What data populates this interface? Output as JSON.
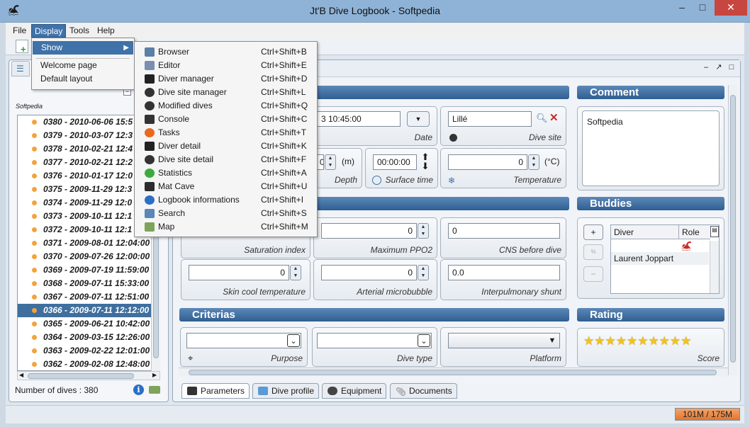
{
  "window": {
    "title": "Jt'B Dive Logbook - Softpedia"
  },
  "menubar": {
    "items": [
      "File",
      "Display",
      "Tools",
      "Help"
    ]
  },
  "display_menu": {
    "show_label": "Show",
    "welcome_page": "Welcome page",
    "default_layout": "Default layout"
  },
  "show_menu": {
    "items": [
      {
        "label": "Browser",
        "shortcut": "Ctrl+Shift+B",
        "icon": "browser-icon"
      },
      {
        "label": "Editor",
        "shortcut": "Ctrl+Shift+E",
        "icon": "editor-icon"
      },
      {
        "label": "Diver manager",
        "shortcut": "Ctrl+Shift+D",
        "icon": "diver-icon"
      },
      {
        "label": "Dive site manager",
        "shortcut": "Ctrl+Shift+L",
        "icon": "globe-icon"
      },
      {
        "label": "Modified dives",
        "shortcut": "Ctrl+Shift+Q",
        "icon": "globe-icon"
      },
      {
        "label": "Console",
        "shortcut": "Ctrl+Shift+C",
        "icon": "console-icon"
      },
      {
        "label": "Tasks",
        "shortcut": "Ctrl+Shift+T",
        "icon": "tasks-icon"
      },
      {
        "label": "Diver detail",
        "shortcut": "Ctrl+Shift+K",
        "icon": "diver-icon"
      },
      {
        "label": "Dive site detail",
        "shortcut": "Ctrl+Shift+F",
        "icon": "globe-icon"
      },
      {
        "label": "Statistics",
        "shortcut": "Ctrl+Shift+A",
        "icon": "pie-chart-icon"
      },
      {
        "label": "Mat Cave",
        "shortcut": "Ctrl+Shift+U",
        "icon": "batman-icon"
      },
      {
        "label": "Logbook informations",
        "shortcut": "Ctrl+Shift+I",
        "icon": "info-icon"
      },
      {
        "label": "Search",
        "shortcut": "Ctrl+Shift+S",
        "icon": "magnifier-icon"
      },
      {
        "label": "Map",
        "shortcut": "Ctrl+Shift+M",
        "icon": "map-icon"
      }
    ]
  },
  "left_panel": {
    "title": "Softpedia",
    "dives": [
      "0380 - 2010-06-06 15:5",
      "0379 - 2010-03-07 12:3",
      "0378 - 2010-02-21 12:4",
      "0377 - 2010-02-21 12:2",
      "0376 - 2010-01-17 12:0",
      "0375 - 2009-11-29 12:3",
      "0374 - 2009-11-29 12:0",
      "0373 - 2009-10-11 12:1",
      "0372 - 2009-10-11 12:1",
      "0371 - 2009-08-01 12:04:00",
      "0370 - 2009-07-26 12:00:00",
      "0369 - 2009-07-19 11:59:00",
      "0368 - 2009-07-11 15:33:00",
      "0367 - 2009-07-11 12:51:00",
      "0366 - 2009-07-11 12:12:00",
      "0365 - 2009-06-21 10:42:00",
      "0364 - 2009-03-15 12:26:00",
      "0363 - 2009-02-22 12:01:00",
      "0362 - 2009-02-08 12:48:00"
    ],
    "selected_index": 14,
    "dive_count": "Number of dives : 380"
  },
  "editor": {
    "sections": {
      "criterias": "Criterias",
      "comment": "Comment",
      "buddies": "Buddies",
      "rating": "Rating"
    },
    "date": {
      "value": "3 10:45:00",
      "label": "Date"
    },
    "dive_site": {
      "value": "Lillé",
      "label": "Dive site"
    },
    "depth": {
      "value": "0",
      "unit": "(m)",
      "label": "Depth"
    },
    "surface_time": {
      "value": "00:00:00",
      "label": "Surface time"
    },
    "temperature": {
      "value": "0",
      "unit": "(°C)",
      "label": "Temperature"
    },
    "saturation_index": {
      "label": "Saturation index"
    },
    "max_ppo2": {
      "value": "0",
      "label": "Maximum PPO2"
    },
    "cns_before": {
      "value": "0",
      "label": "CNS before dive"
    },
    "skin_cool": {
      "value": "0",
      "label": "Skin cool temperature"
    },
    "arterial_micro": {
      "value": "0",
      "label": "Arterial microbubble"
    },
    "interpulmonary": {
      "value": "0.0",
      "label": "Interpulmonary shunt"
    },
    "purpose": {
      "label": "Purpose"
    },
    "dive_type": {
      "label": "Dive type"
    },
    "platform": {
      "label": "Platform"
    },
    "comment_text": "Softpedia",
    "buddies_table": {
      "headers": [
        "Diver",
        "Role"
      ],
      "rows": [
        {
          "diver": "Laurent Joppart",
          "role": ""
        }
      ]
    },
    "buddy_buttons": [
      "+",
      "%",
      "−"
    ],
    "rating": {
      "stars": 10,
      "label": "Score"
    }
  },
  "bottom_tabs": [
    "Parameters",
    "Dive profile",
    "Equipment",
    "Documents"
  ],
  "status": {
    "memory": "101M / 175M"
  },
  "colors": {
    "accent": "#3f72a8",
    "section": "#2f5e91",
    "close": "#c7463f",
    "memory_bar": "#e0772f"
  }
}
